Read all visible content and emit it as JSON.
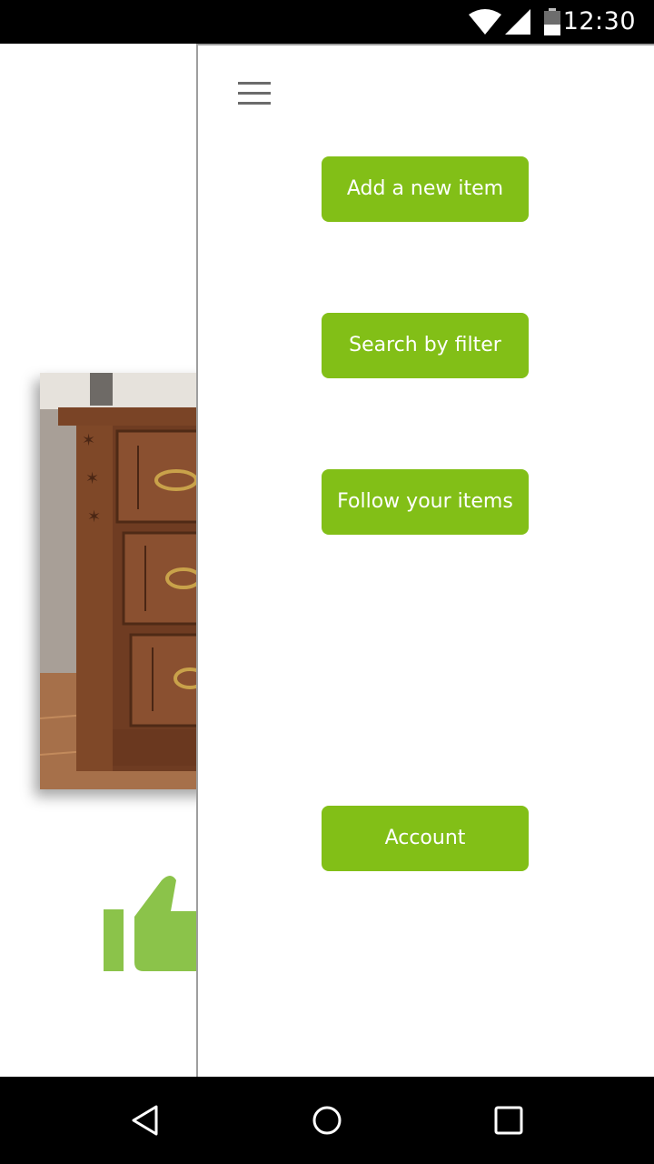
{
  "status_bar": {
    "time": "12:30",
    "icons": [
      "wifi-icon",
      "signal-icon",
      "battery-icon"
    ]
  },
  "background": {
    "photo": "dresser-photo",
    "like_icon": "thumbs-up-icon"
  },
  "drawer": {
    "menu_icon": "hamburger-menu-icon",
    "buttons": {
      "add_item": "Add a new item",
      "search_filter": "Search by filter",
      "follow_items": "Follow your items",
      "account": "Account"
    }
  },
  "nav_bar": {
    "icons": [
      "back-icon",
      "home-icon",
      "recents-icon"
    ]
  },
  "colors": {
    "accent": "#82bf17",
    "like_green": "#8bc34a",
    "system_bar": "#000000"
  }
}
